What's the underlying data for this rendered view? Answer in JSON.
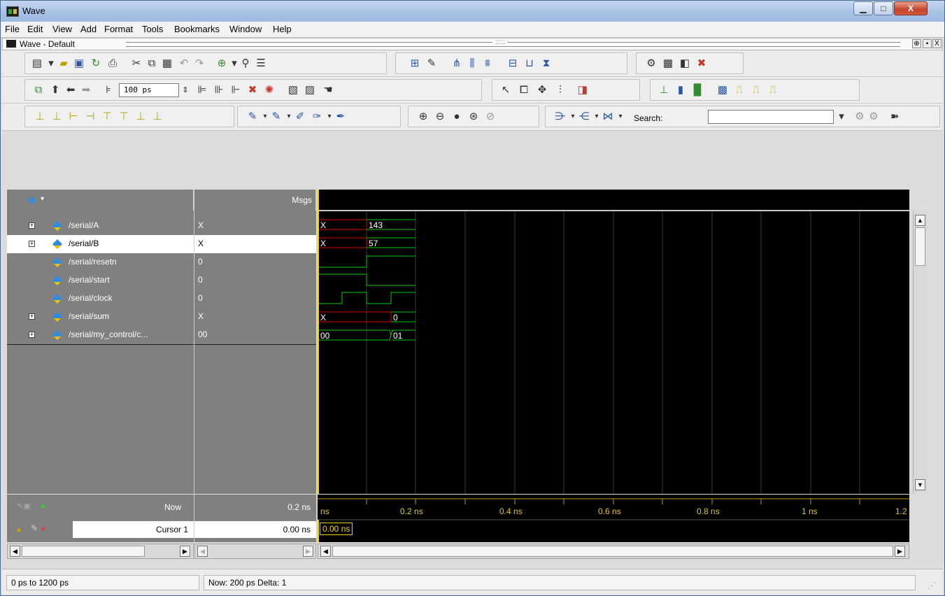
{
  "window": {
    "title": "Wave",
    "minimize": "▁",
    "maximize": "□",
    "close": "X"
  },
  "menu": [
    "File",
    "Edit",
    "View",
    "Add",
    "Format",
    "Tools",
    "Bookmarks",
    "Window",
    "Help"
  ],
  "dock": {
    "title": "Wave - Default",
    "buttons": [
      "⊕",
      "▪",
      "X"
    ]
  },
  "toolbar": {
    "zoom_value": "100 ps",
    "search_label": "Search:",
    "search_value": ""
  },
  "header": {
    "msgs": "Msgs"
  },
  "signals": [
    {
      "name": "/serial/A",
      "value": "X",
      "expandable": true,
      "selected": false
    },
    {
      "name": "/serial/B",
      "value": "X",
      "expandable": true,
      "selected": true
    },
    {
      "name": "/serial/resetn",
      "value": "0",
      "expandable": false,
      "selected": false
    },
    {
      "name": "/serial/start",
      "value": "0",
      "expandable": false,
      "selected": false
    },
    {
      "name": "/serial/clock",
      "value": "0",
      "expandable": false,
      "selected": false
    },
    {
      "name": "/serial/sum",
      "value": "X",
      "expandable": true,
      "selected": false
    },
    {
      "name": "/serial/my_control/c...",
      "value": "00",
      "expandable": true,
      "selected": false
    }
  ],
  "wave_labels": {
    "A": [
      "X",
      "143"
    ],
    "B": [
      "X",
      "57"
    ],
    "sum": [
      "X",
      "0"
    ],
    "ctrl": [
      "00",
      "01"
    ]
  },
  "timeline": {
    "now_label": "Now",
    "now_value": "0.2 ns",
    "cursor_label": "Cursor 1",
    "cursor_value": "0.00 ns",
    "cursor_marker": "0.00 ns",
    "ticks": [
      "ns",
      "0.2 ns",
      "0.4 ns",
      "0.6 ns",
      "0.8 ns",
      "1 ns",
      "1.2"
    ]
  },
  "status": {
    "range": "0 ps to 1200 ps",
    "now": "Now: 200 ps  Delta: 1"
  },
  "colors": {
    "wave_green": "#00d000",
    "wave_red": "#e00000",
    "cursor_yellow": "#f0d000"
  }
}
